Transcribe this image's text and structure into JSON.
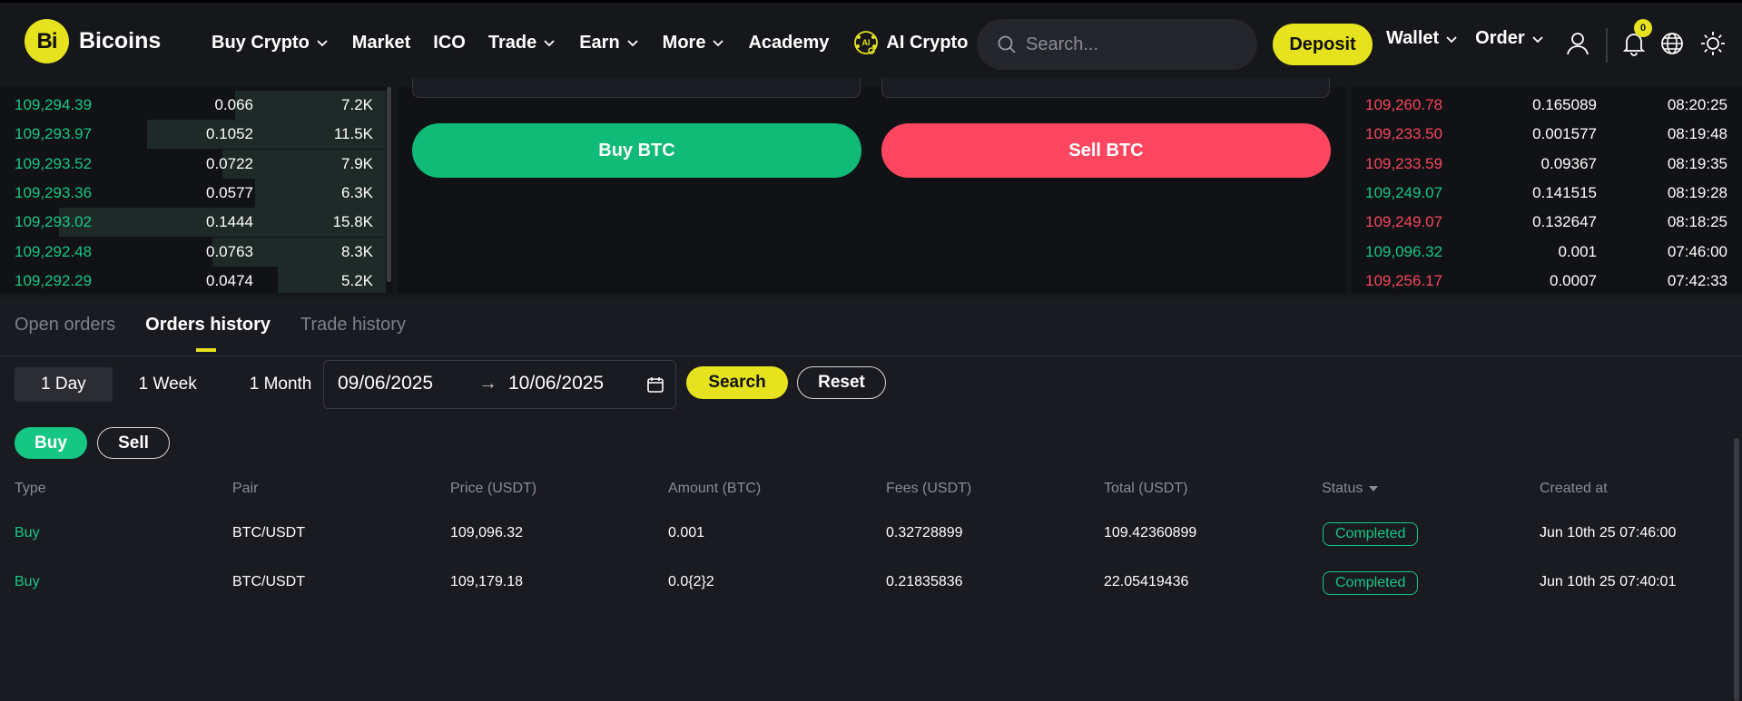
{
  "brand": {
    "logo_mark": "Bi",
    "name": "Bicoins"
  },
  "nav": {
    "items": [
      {
        "label": "Buy Crypto",
        "dropdown": true
      },
      {
        "label": "Market",
        "dropdown": false
      },
      {
        "label": "ICO",
        "dropdown": false
      },
      {
        "label": "Trade",
        "dropdown": true
      },
      {
        "label": "Earn",
        "dropdown": true
      },
      {
        "label": "More",
        "dropdown": true
      },
      {
        "label": "Academy",
        "dropdown": false
      },
      {
        "label": "AI Crypto",
        "dropdown": false,
        "icon": "ai-brain-icon"
      }
    ],
    "search_placeholder": "Search...",
    "deposit_label": "Deposit",
    "wallet_label": "Wallet",
    "order_label": "Order",
    "notification_count": "0",
    "ai_icon_text": "AI"
  },
  "orderbook": {
    "rows": [
      {
        "price": "109,294.39",
        "amount": "0.066",
        "total": "7.2K",
        "depth": 0.46
      },
      {
        "price": "109,293.97",
        "amount": "0.1052",
        "total": "11.5K",
        "depth": 0.73
      },
      {
        "price": "109,293.52",
        "amount": "0.0722",
        "total": "7.9K",
        "depth": 0.5
      },
      {
        "price": "109,293.36",
        "amount": "0.0577",
        "total": "6.3K",
        "depth": 0.4
      },
      {
        "price": "109,293.02",
        "amount": "0.1444",
        "total": "15.8K",
        "depth": 1.0
      },
      {
        "price": "109,292.48",
        "amount": "0.0763",
        "total": "8.3K",
        "depth": 0.53
      },
      {
        "price": "109,292.29",
        "amount": "0.0474",
        "total": "5.2K",
        "depth": 0.33
      }
    ]
  },
  "tradeform": {
    "buy_label": "Buy BTC",
    "sell_label": "Sell BTC"
  },
  "trades": {
    "rows": [
      {
        "price": "109,260.78",
        "amount": "0.165089",
        "time": "08:20:25",
        "side": "sell"
      },
      {
        "price": "109,233.50",
        "amount": "0.001577",
        "time": "08:19:48",
        "side": "sell"
      },
      {
        "price": "109,233.59",
        "amount": "0.09367",
        "time": "08:19:35",
        "side": "sell"
      },
      {
        "price": "109,249.07",
        "amount": "0.141515",
        "time": "08:19:28",
        "side": "buy"
      },
      {
        "price": "109,249.07",
        "amount": "0.132647",
        "time": "08:18:25",
        "side": "sell"
      },
      {
        "price": "109,096.32",
        "amount": "0.001",
        "time": "07:46:00",
        "side": "buy"
      },
      {
        "price": "109,256.17",
        "amount": "0.0007",
        "time": "07:42:33",
        "side": "sell"
      }
    ]
  },
  "history": {
    "tabs": [
      {
        "label": "Open orders",
        "active": false
      },
      {
        "label": "Orders history",
        "active": true
      },
      {
        "label": "Trade history",
        "active": false
      }
    ],
    "ranges": [
      {
        "label": "1 Day",
        "active": true
      },
      {
        "label": "1 Week",
        "active": false
      },
      {
        "label": "1 Month",
        "active": false
      }
    ],
    "date_from": "09/06/2025",
    "date_arrow": "→",
    "date_to": "10/06/2025",
    "search_label": "Search",
    "reset_label": "Reset",
    "side_buy_label": "Buy",
    "side_sell_label": "Sell",
    "columns": [
      "Type",
      "Pair",
      "Price (USDT)",
      "Amount (BTC)",
      "Fees (USDT)",
      "Total (USDT)",
      "Status",
      "Created at"
    ],
    "rows": [
      {
        "type": "Buy",
        "pair": "BTC/USDT",
        "price": "109,096.32",
        "amount": "0.001",
        "fees": "0.32728899",
        "total": "109.42360899",
        "status": "Completed",
        "created": "Jun 10th 25 07:46:00"
      },
      {
        "type": "Buy",
        "pair": "BTC/USDT",
        "price": "109,179.18",
        "amount": "0.0{2}2",
        "fees": "0.21835836",
        "total": "22.05419436",
        "status": "Completed",
        "created": "Jun 10th 25 07:40:01"
      }
    ]
  },
  "colors": {
    "accent": "#e6e21d",
    "buy": "#16c784",
    "sell": "#f6465d",
    "bg": "#16171b",
    "panel": "#111215"
  }
}
